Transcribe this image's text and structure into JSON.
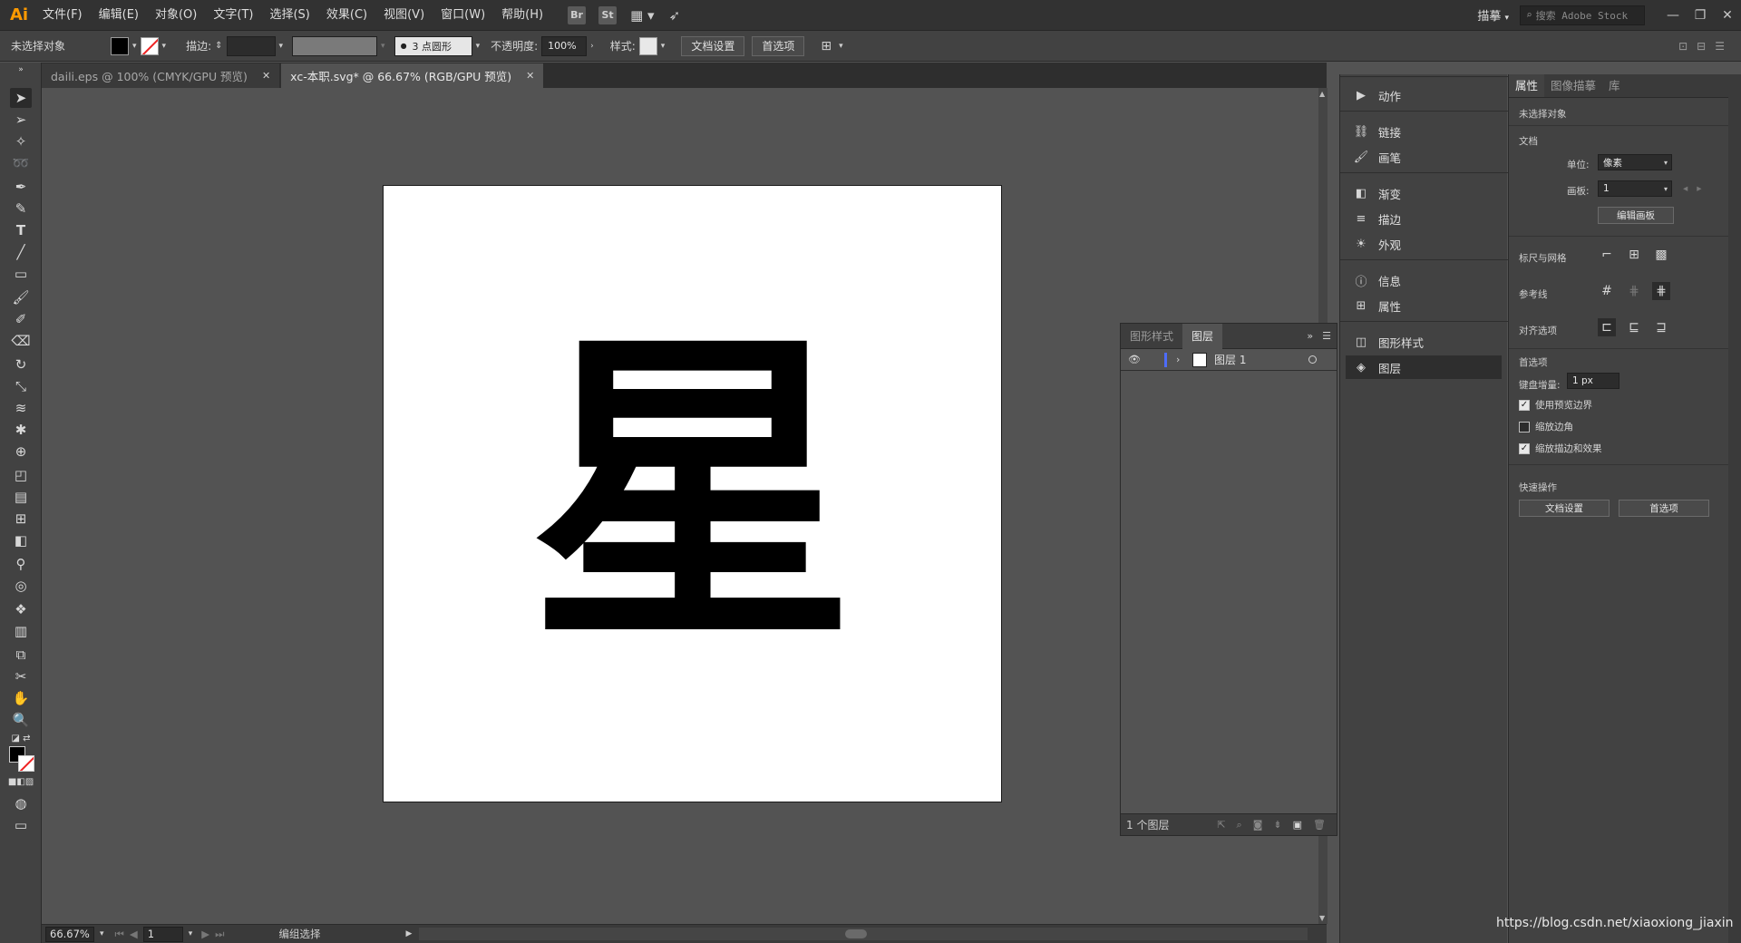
{
  "app": {
    "logo": "Ai"
  },
  "menu": {
    "items": [
      "文件(F)",
      "编辑(E)",
      "对象(O)",
      "文字(T)",
      "选择(S)",
      "效果(C)",
      "视图(V)",
      "窗口(W)",
      "帮助(H)"
    ],
    "icons": [
      {
        "label": "Br"
      },
      {
        "label": "St"
      }
    ]
  },
  "workspace": {
    "label": "描摹"
  },
  "stock_search": {
    "placeholder": "搜索 Adobe Stock"
  },
  "control": {
    "selection": "未选择对象",
    "stroke_label": "描边:",
    "brush": "3 点圆形",
    "opacity_label": "不透明度:",
    "opacity_value": "100%",
    "style_label": "样式:",
    "doc_setup": "文档设置",
    "preferences": "首选项"
  },
  "tabs": [
    {
      "label": "daili.eps @ 100% (CMYK/GPU 预览)",
      "active": false
    },
    {
      "label": "xc-本职.svg* @ 66.67% (RGB/GPU 预览)",
      "active": true
    }
  ],
  "artwork": {
    "glyph": "星"
  },
  "status": {
    "zoom": "66.67%",
    "artboard": "1",
    "tool": "编组选择"
  },
  "layers_panel": {
    "tabs": [
      "图形样式",
      "图层"
    ],
    "layers": [
      {
        "name": "图层 1"
      }
    ],
    "count_label": "1 个图层"
  },
  "dock": {
    "items": [
      {
        "label": "动作",
        "icon": "play-icon"
      },
      {
        "label": "链接",
        "icon": "link-icon"
      },
      {
        "label": "画笔",
        "icon": "brush-icon"
      },
      {
        "label": "渐变",
        "icon": "gradient-icon"
      },
      {
        "label": "描边",
        "icon": "stroke-icon"
      },
      {
        "label": "外观",
        "icon": "appearance-icon"
      },
      {
        "label": "信息",
        "icon": "info-icon"
      },
      {
        "label": "属性",
        "icon": "attributes-icon"
      },
      {
        "label": "图形样式",
        "icon": "graphic-styles-icon"
      },
      {
        "label": "图层",
        "icon": "layers-icon"
      }
    ]
  },
  "properties": {
    "tabs": [
      "属性",
      "图像描摹",
      "库"
    ],
    "selection": "未选择对象",
    "document": {
      "title": "文档",
      "units_label": "单位:",
      "units_value": "像素",
      "artboard_label": "画板:",
      "artboard_value": "1",
      "edit_artboards": "编辑画板"
    },
    "rulers_grids": "标尺与网格",
    "guides": "参考线",
    "snap": "对齐选项",
    "prefs": {
      "title": "首选项",
      "keyboard_increment_label": "键盘增量:",
      "keyboard_increment_value": "1 px",
      "use_preview_bounds": "使用预览边界",
      "scale_corners": "缩放边角",
      "scale_strokes": "缩放描边和效果"
    },
    "quick_actions": {
      "title": "快速操作",
      "doc_setup": "文档设置",
      "preferences": "首选项"
    }
  },
  "watermark": "https://blog.csdn.net/xiaoxiong_jiaxin"
}
